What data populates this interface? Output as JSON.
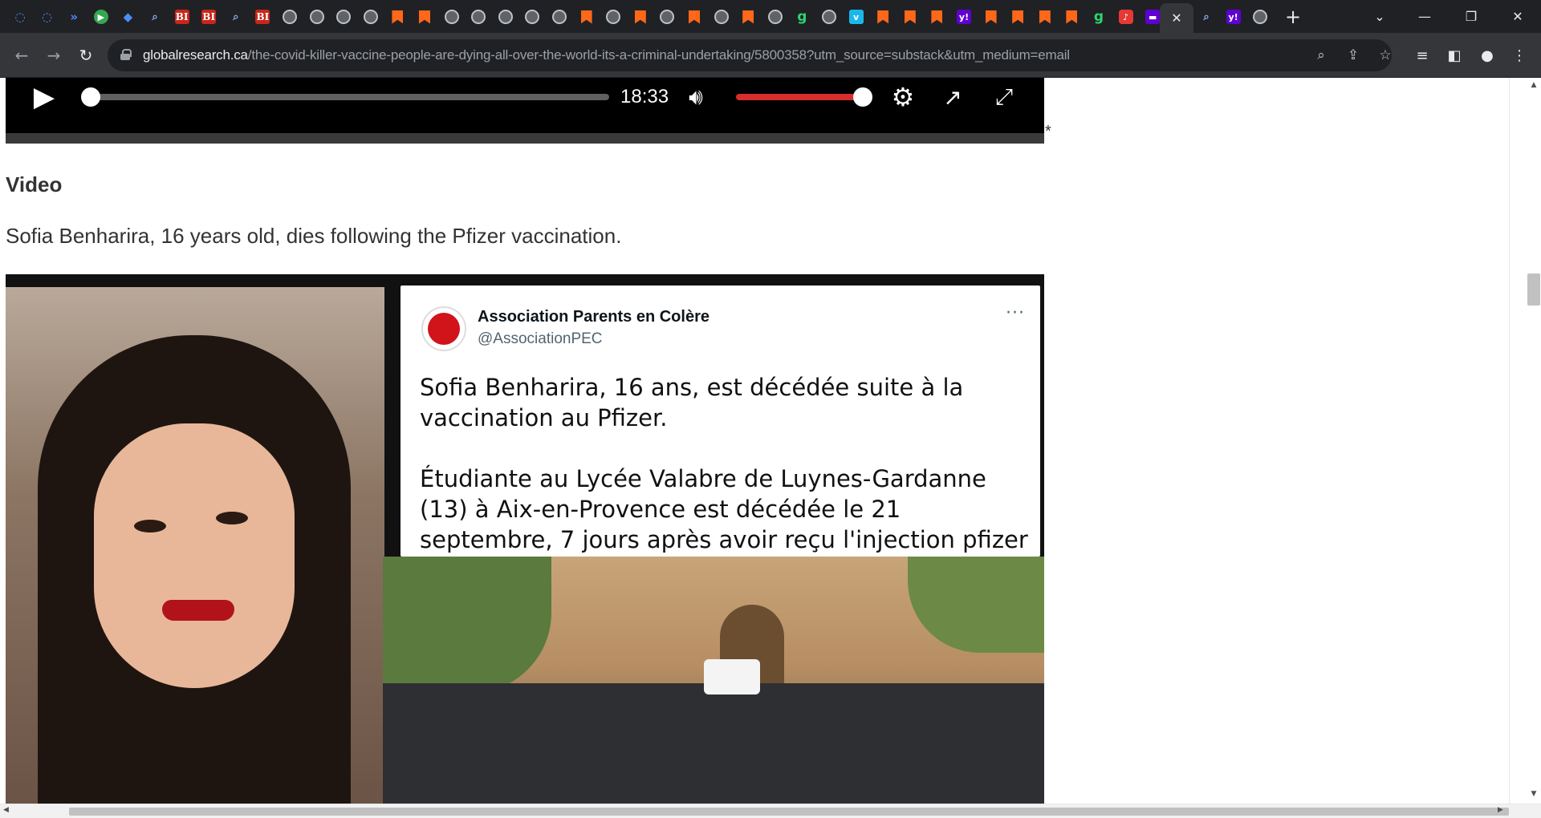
{
  "browser": {
    "tabs": [
      {
        "icon": "shield-icon",
        "glyph": "◌"
      },
      {
        "icon": "shield-icon",
        "glyph": "◌"
      },
      {
        "icon": "tab-stack-icon",
        "glyph": "»"
      },
      {
        "icon": "play-icon",
        "glyph": "▶"
      },
      {
        "icon": "shield-icon",
        "glyph": "◆"
      },
      {
        "icon": "search-icon",
        "glyph": "⌕"
      },
      {
        "icon": "bi-logo-icon",
        "glyph": "BI"
      },
      {
        "icon": "bi-logo-icon",
        "glyph": "BI"
      },
      {
        "icon": "search-icon",
        "glyph": "⌕"
      },
      {
        "icon": "bi-logo-icon",
        "glyph": "BI"
      },
      {
        "icon": "globe-icon",
        "glyph": ""
      },
      {
        "icon": "globe-icon",
        "glyph": ""
      },
      {
        "icon": "globe-icon",
        "glyph": ""
      },
      {
        "icon": "globe-icon",
        "glyph": ""
      },
      {
        "icon": "substack-bookmark-icon",
        "glyph": ""
      },
      {
        "icon": "substack-bookmark-icon",
        "glyph": ""
      },
      {
        "icon": "globe-icon",
        "glyph": ""
      },
      {
        "icon": "globe-icon",
        "glyph": ""
      },
      {
        "icon": "globe-icon",
        "glyph": ""
      },
      {
        "icon": "globe-icon",
        "glyph": ""
      },
      {
        "icon": "globe-icon",
        "glyph": ""
      },
      {
        "icon": "substack-bookmark-icon",
        "glyph": ""
      },
      {
        "icon": "globe-icon",
        "glyph": ""
      },
      {
        "icon": "substack-bookmark-icon",
        "glyph": ""
      },
      {
        "icon": "globe-icon",
        "glyph": ""
      },
      {
        "icon": "substack-bookmark-icon",
        "glyph": ""
      },
      {
        "icon": "globe-icon",
        "glyph": ""
      },
      {
        "icon": "substack-bookmark-icon",
        "glyph": ""
      },
      {
        "icon": "globe-icon",
        "glyph": ""
      },
      {
        "icon": "g-logo-icon",
        "glyph": "g"
      },
      {
        "icon": "globe-icon",
        "glyph": ""
      },
      {
        "icon": "vimeo-icon",
        "glyph": "v"
      },
      {
        "icon": "substack-bookmark-icon",
        "glyph": ""
      },
      {
        "icon": "substack-bookmark-icon",
        "glyph": ""
      },
      {
        "icon": "substack-bookmark-icon",
        "glyph": ""
      },
      {
        "icon": "yahoo-icon",
        "glyph": "y!"
      },
      {
        "icon": "substack-bookmark-icon",
        "glyph": ""
      },
      {
        "icon": "substack-bookmark-icon",
        "glyph": ""
      },
      {
        "icon": "substack-bookmark-icon",
        "glyph": ""
      },
      {
        "icon": "substack-bookmark-icon",
        "glyph": ""
      },
      {
        "icon": "g-logo-icon",
        "glyph": "g"
      },
      {
        "icon": "microphone-icon",
        "glyph": "♪"
      },
      {
        "icon": "tab-purple-icon",
        "glyph": "▬"
      }
    ],
    "tabs_after": [
      {
        "icon": "search-icon",
        "glyph": "⌕"
      },
      {
        "icon": "yahoo-icon",
        "glyph": "y!"
      },
      {
        "icon": "globe-icon",
        "glyph": ""
      }
    ],
    "active_tab_close": "✕",
    "new_tab": "+",
    "url_domain": "globalresearch.ca",
    "url_path": "/the-covid-killer-vaccine-people-are-dying-all-over-the-world-its-a-criminal-undertaking/5800358?utm_source=substack&utm_medium=email"
  },
  "player": {
    "time": "18:33",
    "progress": 0,
    "volume": 1.0
  },
  "article": {
    "asterisk": "*",
    "section_heading": "Video",
    "caption": "Sofia Benharira, 16 years old, dies following the Pfizer vaccination."
  },
  "tweet": {
    "name": "Association Parents en Colère",
    "handle": "@AssociationPEC",
    "more": "···",
    "text_1": "Sofia Benharira, 16 ans, est décédée suite à la vaccination au Pfizer.",
    "text_2": "Étudiante au Lycée Valabre de Luynes-Gardanne (13) à Aix-en-Provence est décédée le 21 septembre, 7 jours après avoir reçu l'injection pfizer ."
  },
  "colors": {
    "chrome_dark": "#202124",
    "toolbar": "#35363a",
    "volume_bar": "#d62d2d",
    "text": "#333333"
  }
}
